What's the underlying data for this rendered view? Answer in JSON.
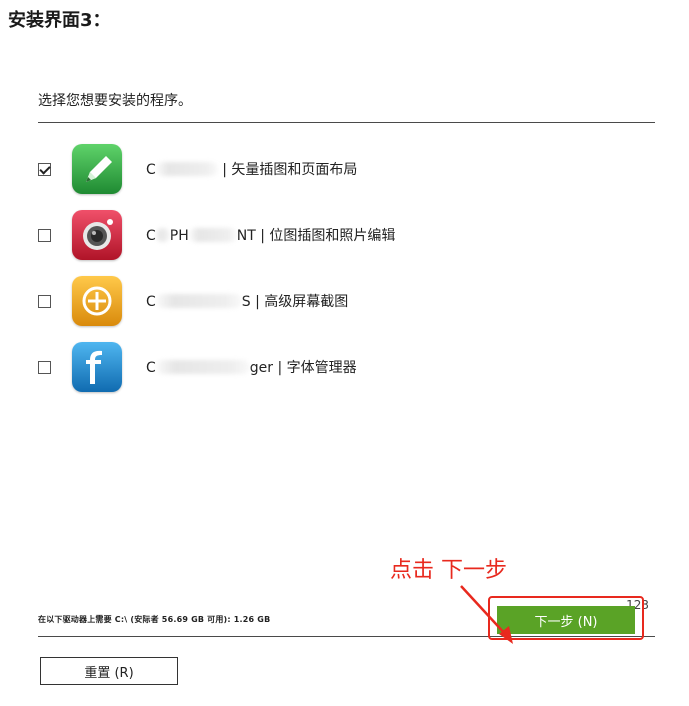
{
  "article": {
    "heading": "安装界面3："
  },
  "installer": {
    "prompt": "选择您想要安装的程序。",
    "programs": [
      {
        "name_prefix": "C",
        "name_suffix": "| 矢量插图和页面布局",
        "checked": true,
        "icon": "pen-icon",
        "icon_color": "#3cae4a"
      },
      {
        "name_prefix": "C",
        "name_mid": "PH",
        "name_suffix": "NT | 位图插图和照片编辑",
        "checked": false,
        "icon": "camera-icon",
        "icon_color": "#d8283c"
      },
      {
        "name_prefix": "C",
        "name_suffix": "S | 高级屏幕截图",
        "checked": false,
        "icon": "capture-icon",
        "icon_color": "#f0a81c"
      },
      {
        "name_prefix": "C",
        "name_suffix": "ger | 字体管理器",
        "checked": false,
        "icon": "font-icon",
        "icon_color": "#1f8fd6"
      }
    ],
    "space_info": "在以下驱动器上需要  C:\\ (安际者  56.69 GB 可用): 1.26 GB",
    "page_number": "123",
    "reset_button": "重置 (R)",
    "next_button": "下一步 (N)",
    "accent_color": "#5aa326"
  },
  "annotation": {
    "text": "点击 下一步",
    "color": "#e8291e"
  }
}
